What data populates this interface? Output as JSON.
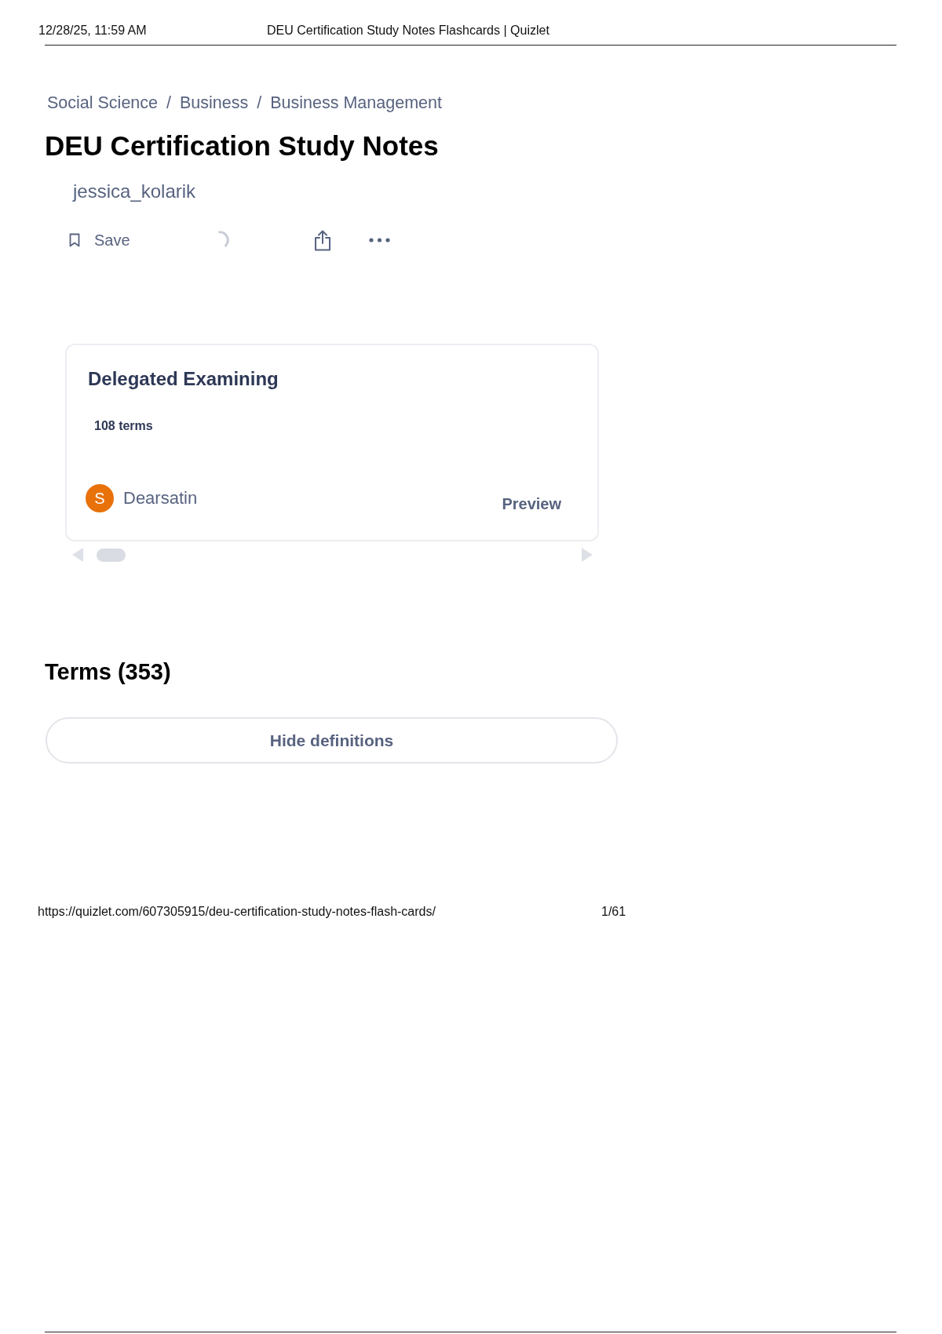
{
  "print_header": {
    "date": "12/28/25, 11:59 AM",
    "title": "DEU Certification Study Notes Flashcards | Quizlet"
  },
  "breadcrumbs": [
    {
      "label": "Social Science",
      "separator": "/"
    },
    {
      "label": "Business",
      "separator": "/"
    },
    {
      "label": "Business Management"
    }
  ],
  "title": "DEU Certification Study Notes",
  "author": "jessica_kolarik",
  "actions": [
    {
      "kind": "save",
      "label": "Save"
    },
    {
      "kind": "loading"
    },
    {
      "kind": "share"
    },
    {
      "kind": "more"
    }
  ],
  "study_sets": [
    {
      "title": "Delegated Examining",
      "count": "108 terms",
      "creator": {
        "initial": "S",
        "name": "Dearsatin",
        "color": "#e8710a"
      },
      "action": "Preview"
    }
  ],
  "terms": {
    "heading": "Terms (353)",
    "toggle_button": "Hide definitions"
  },
  "print_footer": {
    "url": "https://quizlet.com/607305915/deu-certification-study-notes-flash-cards/",
    "page": "1/61"
  }
}
